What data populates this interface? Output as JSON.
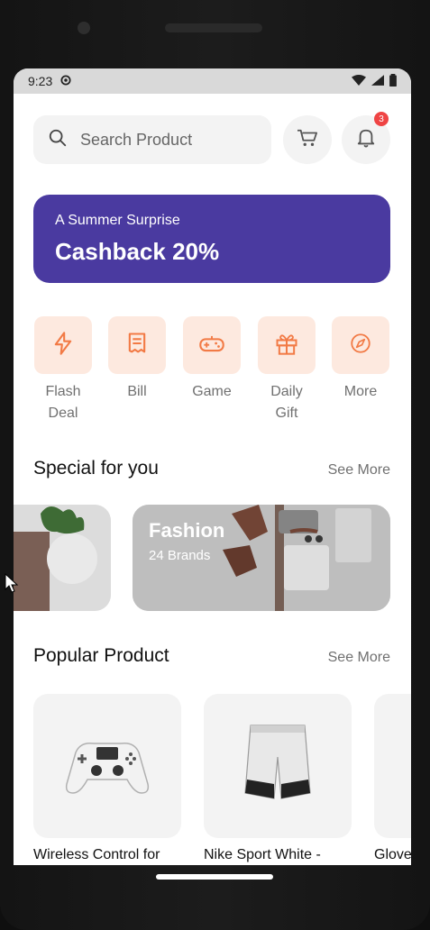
{
  "status": {
    "time": "9:23",
    "left_icon": "gear-icon",
    "right_icons": [
      "wifi-icon",
      "signal-icon",
      "battery-icon"
    ]
  },
  "search": {
    "placeholder": "Search Product"
  },
  "header_actions": {
    "cart_icon": "cart-icon",
    "notification_icon": "bell-icon",
    "notification_count": "3"
  },
  "banner": {
    "subtitle": "A Summer Surprise",
    "title": "Cashback 20%",
    "bg_color": "#4a3aa0"
  },
  "categories": [
    {
      "label": "Flash\nDeal",
      "icon": "flash-icon"
    },
    {
      "label": "Bill",
      "icon": "bill-icon"
    },
    {
      "label": "Game",
      "icon": "game-controller-icon"
    },
    {
      "label": "Daily\nGift",
      "icon": "gift-icon"
    },
    {
      "label": "More",
      "icon": "explore-icon"
    }
  ],
  "sections": {
    "special": {
      "title": "Special for you",
      "see_more": "See More"
    },
    "popular": {
      "title": "Popular Product",
      "see_more": "See More"
    }
  },
  "special_cards": [
    {
      "title": "Fashion",
      "subtitle": "24 Brands"
    }
  ],
  "products": [
    {
      "name": "Wireless Control for"
    },
    {
      "name": "Nike Sport White -"
    },
    {
      "name": "Glove"
    }
  ],
  "colors": {
    "accent": "#4a3aa0",
    "tile": "#fde9df",
    "icon": "#f27a45",
    "badge": "#ef4444"
  }
}
